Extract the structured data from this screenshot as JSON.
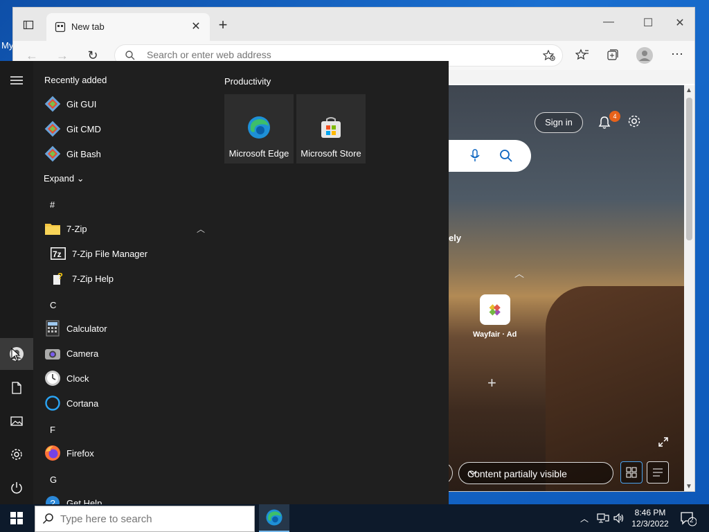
{
  "desktop": {
    "label": "My"
  },
  "browser": {
    "tab": {
      "title": "New tab",
      "close": "✕"
    },
    "new_tab": "+",
    "window": {
      "minimize": "—",
      "maximize": "☐",
      "close": "✕"
    },
    "address": {
      "placeholder": "Search or enter web address"
    },
    "more": "⋯"
  },
  "newtab_page": {
    "signin": "Sign in",
    "notification_count": "4",
    "partial_text": "ely",
    "shortcut": {
      "label": "Wayfair · Ad"
    },
    "content_dropdown": "Content partially visible"
  },
  "start_menu": {
    "recently_added_title": "Recently added",
    "recently_added": [
      {
        "label": "Git GUI"
      },
      {
        "label": "Git CMD"
      },
      {
        "label": "Git Bash"
      }
    ],
    "expand_label": "Expand",
    "letters": {
      "hash": "#",
      "c": "C",
      "f": "F",
      "g": "G"
    },
    "apps": {
      "sevenzip": "7-Zip",
      "sevenzip_fm": "7-Zip File Manager",
      "sevenzip_help": "7-Zip Help",
      "calculator": "Calculator",
      "camera": "Camera",
      "clock": "Clock",
      "cortana": "Cortana",
      "firefox": "Firefox",
      "gethelp": "Get Help"
    },
    "tiles_title": "Productivity",
    "tiles": [
      {
        "label": "Microsoft Edge"
      },
      {
        "label": "Microsoft Store"
      }
    ]
  },
  "taskbar": {
    "search_placeholder": "Type here to search",
    "time": "8:46 PM",
    "date": "12/3/2022",
    "notification_count": "2"
  },
  "colors": {
    "accent": "#0078d4",
    "edge_blue": "#1e90d6",
    "edge_green": "#3dbf6a",
    "badge": "#e8621a"
  }
}
